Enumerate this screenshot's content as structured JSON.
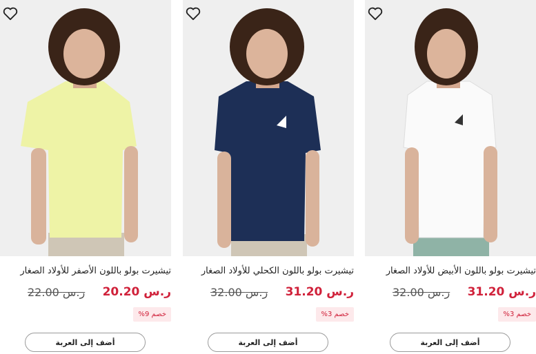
{
  "products": [
    {
      "title": "تيشيرت بولو باللون الأصفر للأولاد الصغار",
      "price": "20.20 ر.س",
      "old_price": "22.00 ر.س",
      "discount": "خصم 9%",
      "add_to_cart": "أضف إلى العربة",
      "shirt_color": "#eef3a6",
      "pants_color": "#cfc6b6"
    },
    {
      "title": "تيشيرت بولو باللون الكحلي للأولاد الصغار",
      "price": "31.20 ر.س",
      "old_price": "32.00 ر.س",
      "discount": "خصم 3%",
      "add_to_cart": "أضف إلى العربة",
      "shirt_color": "#1d2f56",
      "pants_color": "#cfc6b6"
    },
    {
      "title": "تيشيرت بولو باللون الأبيض للأولاد الصغار",
      "price": "31.20 ر.س",
      "old_price": "32.00 ر.س",
      "discount": "خصم 3%",
      "add_to_cart": "أضف إلى العربة",
      "shirt_color": "#fafafa",
      "pants_color": "#8fb3a6"
    }
  ],
  "icons": {
    "wishlist": "heart-outline-icon"
  },
  "colors": {
    "price": "#d0213a",
    "badge_bg": "#fde9eb",
    "background": "#efefef"
  }
}
